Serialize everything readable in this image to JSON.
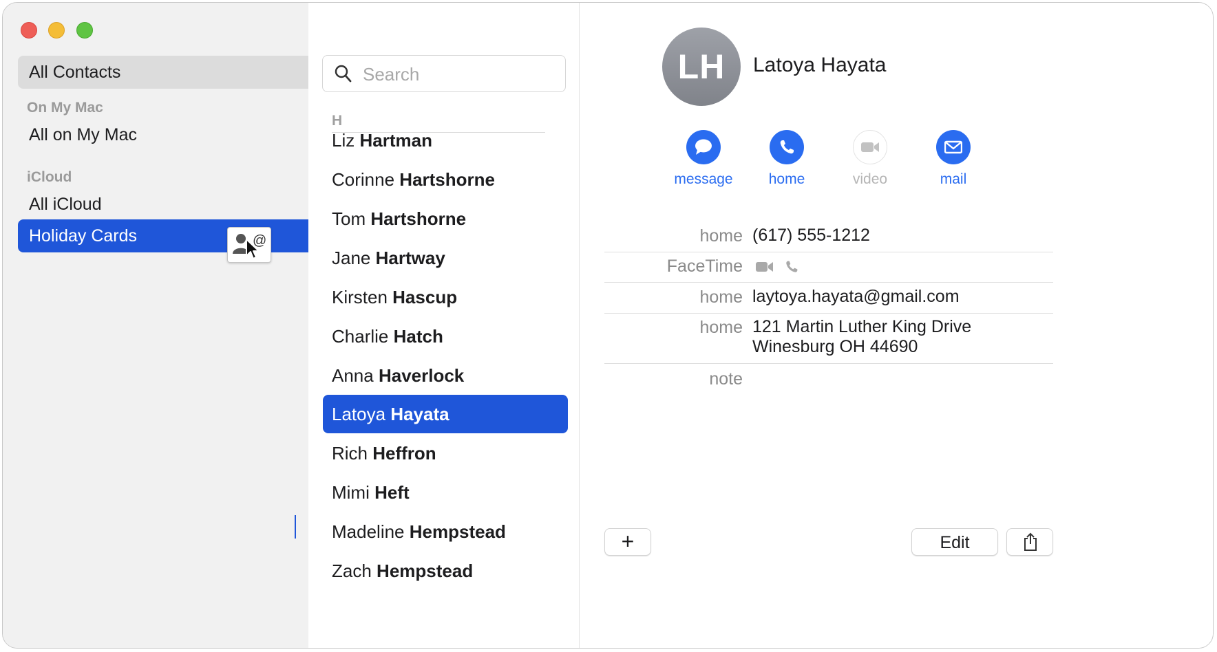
{
  "sidebar": {
    "all_contacts": "All Contacts",
    "on_my_mac_header": "On My Mac",
    "all_on_my_mac": "All on My Mac",
    "icloud_header": "iCloud",
    "all_icloud": "All iCloud",
    "holiday_cards": "Holiday Cards",
    "drag_card_symbol": "@"
  },
  "list": {
    "search_placeholder": "Search",
    "section_letter": "H",
    "contacts": [
      {
        "first": "Liz",
        "last": "Hartman"
      },
      {
        "first": "Corinne",
        "last": "Hartshorne"
      },
      {
        "first": "Tom",
        "last": "Hartshorne"
      },
      {
        "first": "Jane",
        "last": "Hartway"
      },
      {
        "first": "Kirsten",
        "last": "Hascup"
      },
      {
        "first": "Charlie",
        "last": "Hatch"
      },
      {
        "first": "Anna",
        "last": "Haverlock"
      },
      {
        "first": "Latoya",
        "last": "Hayata"
      },
      {
        "first": "Rich",
        "last": "Heffron"
      },
      {
        "first": "Mimi",
        "last": "Heft"
      },
      {
        "first": "Madeline",
        "last": "Hempstead"
      },
      {
        "first": "Zach",
        "last": "Hempstead"
      }
    ]
  },
  "detail": {
    "initials": "LH",
    "name": "Latoya Hayata",
    "actions": {
      "message": "message",
      "home": "home",
      "video": "video",
      "mail": "mail"
    },
    "fields": {
      "phone_label": "home",
      "phone_value": "(617) 555-1212",
      "facetime_label": "FaceTime",
      "email_label": "home",
      "email_value": "laytoya.hayata@gmail.com",
      "address_label": "home",
      "address_line1": "121 Martin Luther King Drive",
      "address_line2": "Winesburg OH 44690",
      "note_label": "note"
    },
    "buttons": {
      "add": "+",
      "edit": "Edit"
    }
  },
  "colors": {
    "accent": "#1f56d9",
    "action_blue": "#2a6cf0",
    "sidebar_bg": "#f1f1f1"
  },
  "icons": [
    "search-icon",
    "message-icon",
    "phone-icon",
    "video-icon",
    "mail-icon",
    "share-icon",
    "person-icon",
    "pointer-cursor-icon"
  ]
}
